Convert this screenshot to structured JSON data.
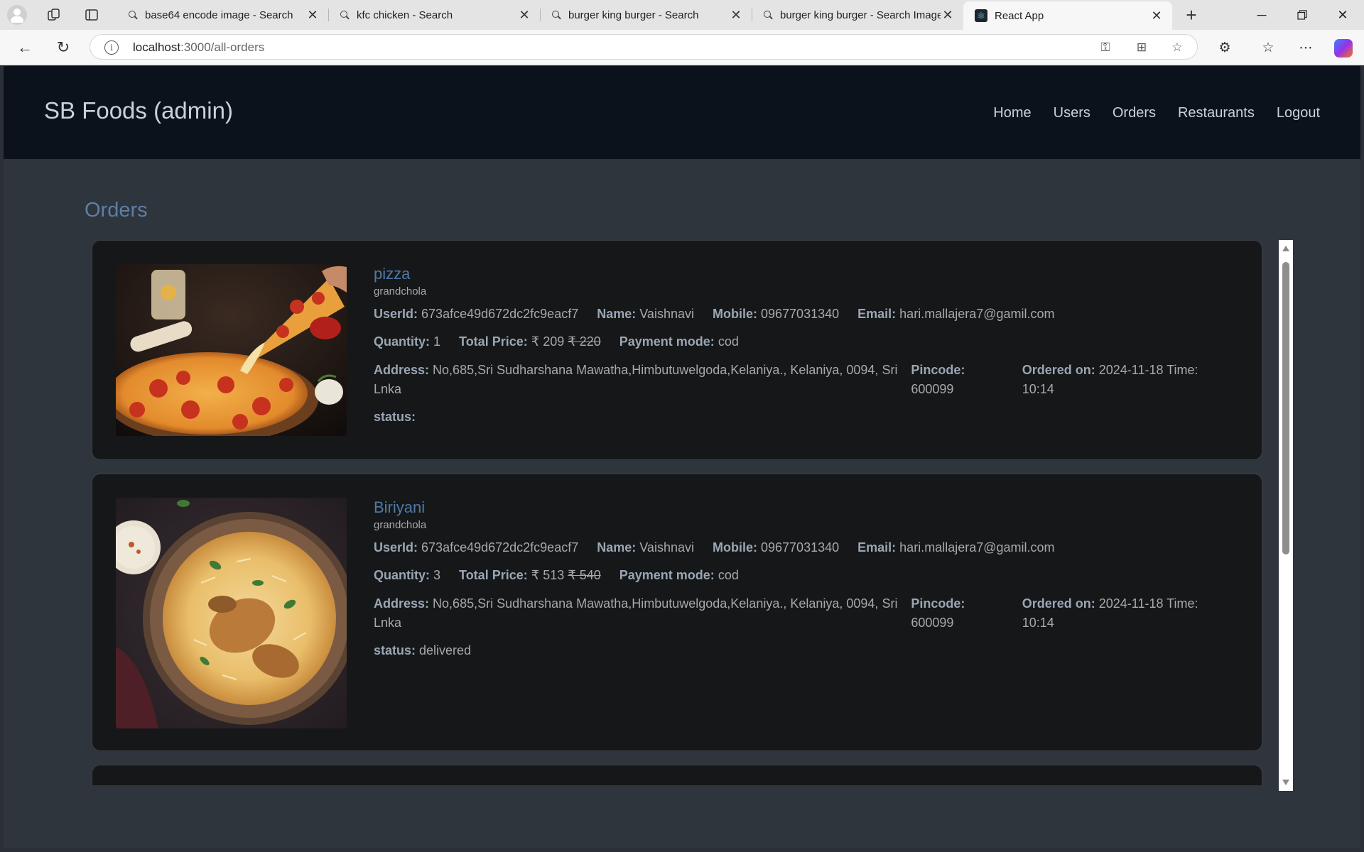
{
  "browser": {
    "tabs": [
      {
        "title": "base64 encode image - Search",
        "icon": "search-icon"
      },
      {
        "title": "kfc chicken - Search",
        "icon": "search-icon"
      },
      {
        "title": "burger king burger - Search",
        "icon": "search-icon"
      },
      {
        "title": "burger king burger - Search Images",
        "icon": "search-icon"
      },
      {
        "title": "React App",
        "icon": "react-icon",
        "active": true
      }
    ],
    "url_host": "localhost",
    "url_path": ":3000/all-orders"
  },
  "header": {
    "brand": "SB Foods (admin)",
    "nav": [
      "Home",
      "Users",
      "Orders",
      "Restaurants",
      "Logout"
    ]
  },
  "page": {
    "title": "Orders"
  },
  "labels": {
    "userid": "UserId:",
    "name": "Name:",
    "mobile": "Mobile:",
    "email": "Email:",
    "quantity": "Quantity:",
    "total_price": "Total Price:",
    "payment_mode": "Payment mode:",
    "address": "Address:",
    "pincode": "Pincode:",
    "ordered_on": "Ordered on:",
    "status": "status:"
  },
  "orders": [
    {
      "food": "pizza",
      "restaurant": "grandchola",
      "userid": "673afce49d672dc2fc9eacf7",
      "name": "Vaishnavi",
      "mobile": "09677031340",
      "email": "hari.mallajera7@gamil.com",
      "quantity": "1",
      "price": "₹ 209",
      "old_price": "₹ 220",
      "payment": "cod",
      "address": "No,685,Sri Sudharshana Mawatha,Himbutuwelgoda,Kelaniya., Kelaniya, 0094, Sri Lnka",
      "pincode": "600099",
      "ordered_on": "2024-11-18 Time: 10:14",
      "status": ""
    },
    {
      "food": "Biriyani",
      "restaurant": "grandchola",
      "userid": "673afce49d672dc2fc9eacf7",
      "name": "Vaishnavi",
      "mobile": "09677031340",
      "email": "hari.mallajera7@gamil.com",
      "quantity": "3",
      "price": "₹ 513",
      "old_price": "₹ 540",
      "payment": "cod",
      "address": "No,685,Sri Sudharshana Mawatha,Himbutuwelgoda,Kelaniya., Kelaniya, 0094, Sri Lnka",
      "pincode": "600099",
      "ordered_on": "2024-11-18 Time: 10:14",
      "status": "delivered"
    }
  ]
}
